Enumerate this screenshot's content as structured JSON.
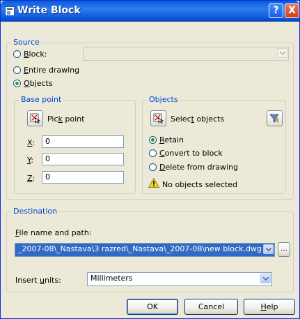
{
  "window": {
    "title": "Write Block"
  },
  "titlebar_buttons": {
    "help": "?",
    "close": "X"
  },
  "source": {
    "legend": "Source",
    "block_option": {
      "label": "lock:",
      "accel": "B",
      "checked": false
    },
    "entire_option": {
      "label": "ntire drawing",
      "accel": "E",
      "checked": false
    },
    "objects_option": {
      "label": "bjects",
      "accel": "O",
      "checked": true
    },
    "block_combo_value": ""
  },
  "base_point": {
    "legend": "Base point",
    "pick_label_pre": "Pic",
    "pick_label_accel": "k",
    "pick_label_post": " point",
    "x_label": "X",
    "x_suffix": ":",
    "x_value": "0",
    "y_label": "Y",
    "y_suffix": ":",
    "y_value": "0",
    "z_label": "Z",
    "z_suffix": ":",
    "z_value": "0"
  },
  "objects": {
    "legend": "Objects",
    "select_pre": "Selec",
    "select_accel": "t",
    "select_post": " objects",
    "retain": {
      "accel": "R",
      "label": "etain",
      "checked": true
    },
    "convert": {
      "accel": "C",
      "label": "onvert to block",
      "checked": false
    },
    "delete": {
      "accel": "D",
      "label": "elete from drawing",
      "checked": false
    },
    "status": "No objects selected"
  },
  "destination": {
    "legend": "Destination",
    "path_label_accel": "F",
    "path_label_rest": "ile name and path:",
    "path_value": "_2007-08\\_Nastava\\3 razred\\_Nastava\\_2007-08\\new block.dwg",
    "browse_label": "...",
    "units_label_pre": "Insert ",
    "units_label_accel": "u",
    "units_label_post": "nits:",
    "units_value": "Millimeters"
  },
  "buttons": {
    "ok": "OK",
    "cancel": "Cancel",
    "help_accel": "H",
    "help_rest": "elp"
  },
  "colors": {
    "accent": "#0046d5",
    "selection": "#316ac5",
    "titlebar": "#0a5bd8"
  }
}
